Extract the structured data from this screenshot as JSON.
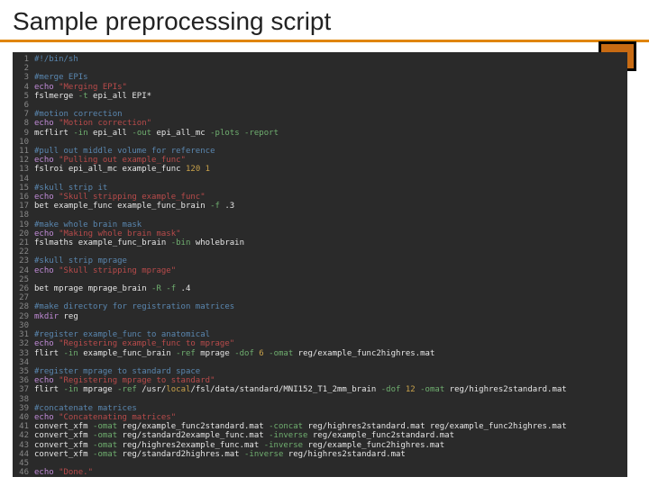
{
  "title": "Sample preprocessing script",
  "lines": [
    {
      "n": 1,
      "segs": [
        {
          "t": "#!/bin/sh",
          "c": "c-comment"
        }
      ]
    },
    {
      "n": 2,
      "segs": []
    },
    {
      "n": 3,
      "segs": [
        {
          "t": "#merge EPIs",
          "c": "c-comment"
        }
      ]
    },
    {
      "n": 4,
      "segs": [
        {
          "t": "echo ",
          "c": "c-cmd"
        },
        {
          "t": "\"Merging EPIs\"",
          "c": "c-str"
        }
      ]
    },
    {
      "n": 5,
      "segs": [
        {
          "t": "fslmerge ",
          "c": "c-bin"
        },
        {
          "t": "-t",
          "c": "c-flag"
        },
        {
          "t": " epi_all EPI*",
          "c": "c-arg"
        }
      ]
    },
    {
      "n": 6,
      "segs": []
    },
    {
      "n": 7,
      "segs": [
        {
          "t": "#motion correction",
          "c": "c-comment"
        }
      ]
    },
    {
      "n": 8,
      "segs": [
        {
          "t": "echo ",
          "c": "c-cmd"
        },
        {
          "t": "\"Motion correction\"",
          "c": "c-str"
        }
      ]
    },
    {
      "n": 9,
      "segs": [
        {
          "t": "mcflirt ",
          "c": "c-bin"
        },
        {
          "t": "-in",
          "c": "c-flag"
        },
        {
          "t": " epi_all ",
          "c": "c-arg"
        },
        {
          "t": "-out",
          "c": "c-flag"
        },
        {
          "t": " epi_all_mc ",
          "c": "c-arg"
        },
        {
          "t": "-plots -report",
          "c": "c-flag"
        }
      ]
    },
    {
      "n": 10,
      "segs": []
    },
    {
      "n": 11,
      "segs": [
        {
          "t": "#pull out middle volume for reference",
          "c": "c-comment"
        }
      ]
    },
    {
      "n": 12,
      "segs": [
        {
          "t": "echo ",
          "c": "c-cmd"
        },
        {
          "t": "\"Pulling out example_func\"",
          "c": "c-str"
        }
      ]
    },
    {
      "n": 13,
      "segs": [
        {
          "t": "fslroi epi_all_mc example_func ",
          "c": "c-bin"
        },
        {
          "t": "120 1",
          "c": "c-num"
        }
      ]
    },
    {
      "n": 14,
      "segs": []
    },
    {
      "n": 15,
      "segs": [
        {
          "t": "#skull strip it",
          "c": "c-comment"
        }
      ]
    },
    {
      "n": 16,
      "segs": [
        {
          "t": "echo ",
          "c": "c-cmd"
        },
        {
          "t": "\"Skull stripping example_func\"",
          "c": "c-str"
        }
      ]
    },
    {
      "n": 17,
      "segs": [
        {
          "t": "bet example_func example_func_brain ",
          "c": "c-bin"
        },
        {
          "t": "-f",
          "c": "c-flag"
        },
        {
          "t": " .3",
          "c": "c-arg"
        }
      ]
    },
    {
      "n": 18,
      "segs": []
    },
    {
      "n": 19,
      "segs": [
        {
          "t": "#make whole brain mask",
          "c": "c-comment"
        }
      ]
    },
    {
      "n": 20,
      "segs": [
        {
          "t": "echo ",
          "c": "c-cmd"
        },
        {
          "t": "\"Making whole brain mask\"",
          "c": "c-str"
        }
      ]
    },
    {
      "n": 21,
      "segs": [
        {
          "t": "fslmaths example_func_brain ",
          "c": "c-bin"
        },
        {
          "t": "-bin",
          "c": "c-flag"
        },
        {
          "t": " wholebrain",
          "c": "c-arg"
        }
      ]
    },
    {
      "n": 22,
      "segs": []
    },
    {
      "n": 23,
      "segs": [
        {
          "t": "#skull strip mprage",
          "c": "c-comment"
        }
      ]
    },
    {
      "n": 24,
      "segs": [
        {
          "t": "echo ",
          "c": "c-cmd"
        },
        {
          "t": "\"Skull stripping mprage\"",
          "c": "c-str"
        }
      ]
    },
    {
      "n": 25,
      "segs": []
    },
    {
      "n": 26,
      "segs": [
        {
          "t": "bet mprage mprage_brain ",
          "c": "c-bin"
        },
        {
          "t": "-R -f",
          "c": "c-flag"
        },
        {
          "t": " .4",
          "c": "c-arg"
        }
      ]
    },
    {
      "n": 27,
      "segs": []
    },
    {
      "n": 28,
      "segs": [
        {
          "t": "#make directory for registration matrices",
          "c": "c-comment"
        }
      ]
    },
    {
      "n": 29,
      "segs": [
        {
          "t": "mkdir ",
          "c": "c-cmd"
        },
        {
          "t": "reg",
          "c": "c-arg"
        }
      ]
    },
    {
      "n": 30,
      "segs": []
    },
    {
      "n": 31,
      "segs": [
        {
          "t": "#register example_func to anatomical",
          "c": "c-comment"
        }
      ]
    },
    {
      "n": 32,
      "segs": [
        {
          "t": "echo ",
          "c": "c-cmd"
        },
        {
          "t": "\"Registering example_func to mprage\"",
          "c": "c-str"
        }
      ]
    },
    {
      "n": 33,
      "segs": [
        {
          "t": "flirt ",
          "c": "c-bin"
        },
        {
          "t": "-in",
          "c": "c-flag"
        },
        {
          "t": " example_func_brain ",
          "c": "c-arg"
        },
        {
          "t": "-ref",
          "c": "c-flag"
        },
        {
          "t": " mprage ",
          "c": "c-arg"
        },
        {
          "t": "-dof",
          "c": "c-flag"
        },
        {
          "t": " 6 ",
          "c": "c-num"
        },
        {
          "t": "-omat",
          "c": "c-flag"
        },
        {
          "t": " reg/example_func2highres.mat",
          "c": "c-arg"
        }
      ]
    },
    {
      "n": 34,
      "segs": []
    },
    {
      "n": 35,
      "segs": [
        {
          "t": "#register mprage to standard space",
          "c": "c-comment"
        }
      ]
    },
    {
      "n": 36,
      "segs": [
        {
          "t": "echo ",
          "c": "c-cmd"
        },
        {
          "t": "\"Registering mprage to standard\"",
          "c": "c-str"
        }
      ]
    },
    {
      "n": 37,
      "segs": [
        {
          "t": "flirt ",
          "c": "c-bin"
        },
        {
          "t": "-in",
          "c": "c-flag"
        },
        {
          "t": " mprage ",
          "c": "c-arg"
        },
        {
          "t": "-ref",
          "c": "c-flag"
        },
        {
          "t": " /usr/",
          "c": "c-arg"
        },
        {
          "t": "local",
          "c": "c-path"
        },
        {
          "t": "/fsl/data/standard/MNI152_T1_2mm_brain ",
          "c": "c-arg"
        },
        {
          "t": "-dof",
          "c": "c-flag"
        },
        {
          "t": " 12 ",
          "c": "c-num"
        },
        {
          "t": "-omat",
          "c": "c-flag"
        },
        {
          "t": " reg/highres2standard.mat",
          "c": "c-arg"
        }
      ]
    },
    {
      "n": 38,
      "segs": []
    },
    {
      "n": 39,
      "segs": [
        {
          "t": "#concatenate matrices",
          "c": "c-comment"
        }
      ]
    },
    {
      "n": 40,
      "segs": [
        {
          "t": "echo ",
          "c": "c-cmd"
        },
        {
          "t": "\"Concatenating matrices\"",
          "c": "c-str"
        }
      ]
    },
    {
      "n": 41,
      "segs": [
        {
          "t": "convert_xfm ",
          "c": "c-bin"
        },
        {
          "t": "-omat",
          "c": "c-flag"
        },
        {
          "t": " reg/example_func2standard.mat ",
          "c": "c-arg"
        },
        {
          "t": "-concat",
          "c": "c-flag"
        },
        {
          "t": " reg/highres2standard.mat reg/example_func2highres.mat",
          "c": "c-arg"
        }
      ]
    },
    {
      "n": 42,
      "segs": [
        {
          "t": "convert_xfm ",
          "c": "c-bin"
        },
        {
          "t": "-omat",
          "c": "c-flag"
        },
        {
          "t": " reg/standard2example_func.mat ",
          "c": "c-arg"
        },
        {
          "t": "-inverse",
          "c": "c-flag"
        },
        {
          "t": " reg/example_func2standard.mat",
          "c": "c-arg"
        }
      ]
    },
    {
      "n": 43,
      "segs": [
        {
          "t": "convert_xfm ",
          "c": "c-bin"
        },
        {
          "t": "-omat",
          "c": "c-flag"
        },
        {
          "t": " reg/highres2example_func.mat ",
          "c": "c-arg"
        },
        {
          "t": "-inverse",
          "c": "c-flag"
        },
        {
          "t": " reg/example_func2highres.mat",
          "c": "c-arg"
        }
      ]
    },
    {
      "n": 44,
      "segs": [
        {
          "t": "convert_xfm ",
          "c": "c-bin"
        },
        {
          "t": "-omat",
          "c": "c-flag"
        },
        {
          "t": " reg/standard2highres.mat ",
          "c": "c-arg"
        },
        {
          "t": "-inverse",
          "c": "c-flag"
        },
        {
          "t": " reg/highres2standard.mat",
          "c": "c-arg"
        }
      ]
    },
    {
      "n": 45,
      "segs": []
    },
    {
      "n": 46,
      "segs": [
        {
          "t": "echo ",
          "c": "c-cmd"
        },
        {
          "t": "\"Done.\"",
          "c": "c-str"
        }
      ]
    }
  ]
}
